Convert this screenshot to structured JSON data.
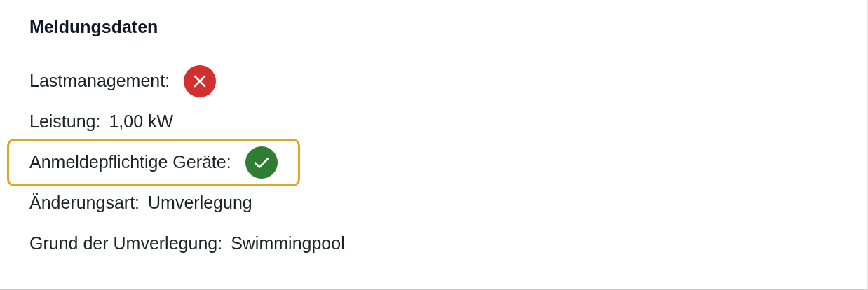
{
  "section": {
    "title": "Meldungsdaten"
  },
  "fields": [
    {
      "kind": "status",
      "label": "Lastmanagement:",
      "ok": false,
      "highlighted": false
    },
    {
      "kind": "text",
      "label": "Leistung:",
      "value": "1,00 kW",
      "highlighted": false
    },
    {
      "kind": "status",
      "label": "Anmeldepflichtige Geräte:",
      "ok": true,
      "highlighted": true
    },
    {
      "kind": "text",
      "label": "Änderungsart:",
      "value": "Umverlegung",
      "highlighted": false
    },
    {
      "kind": "text",
      "label": "Grund der Umverlegung:",
      "value": "Swimmingpool",
      "highlighted": false
    }
  ]
}
